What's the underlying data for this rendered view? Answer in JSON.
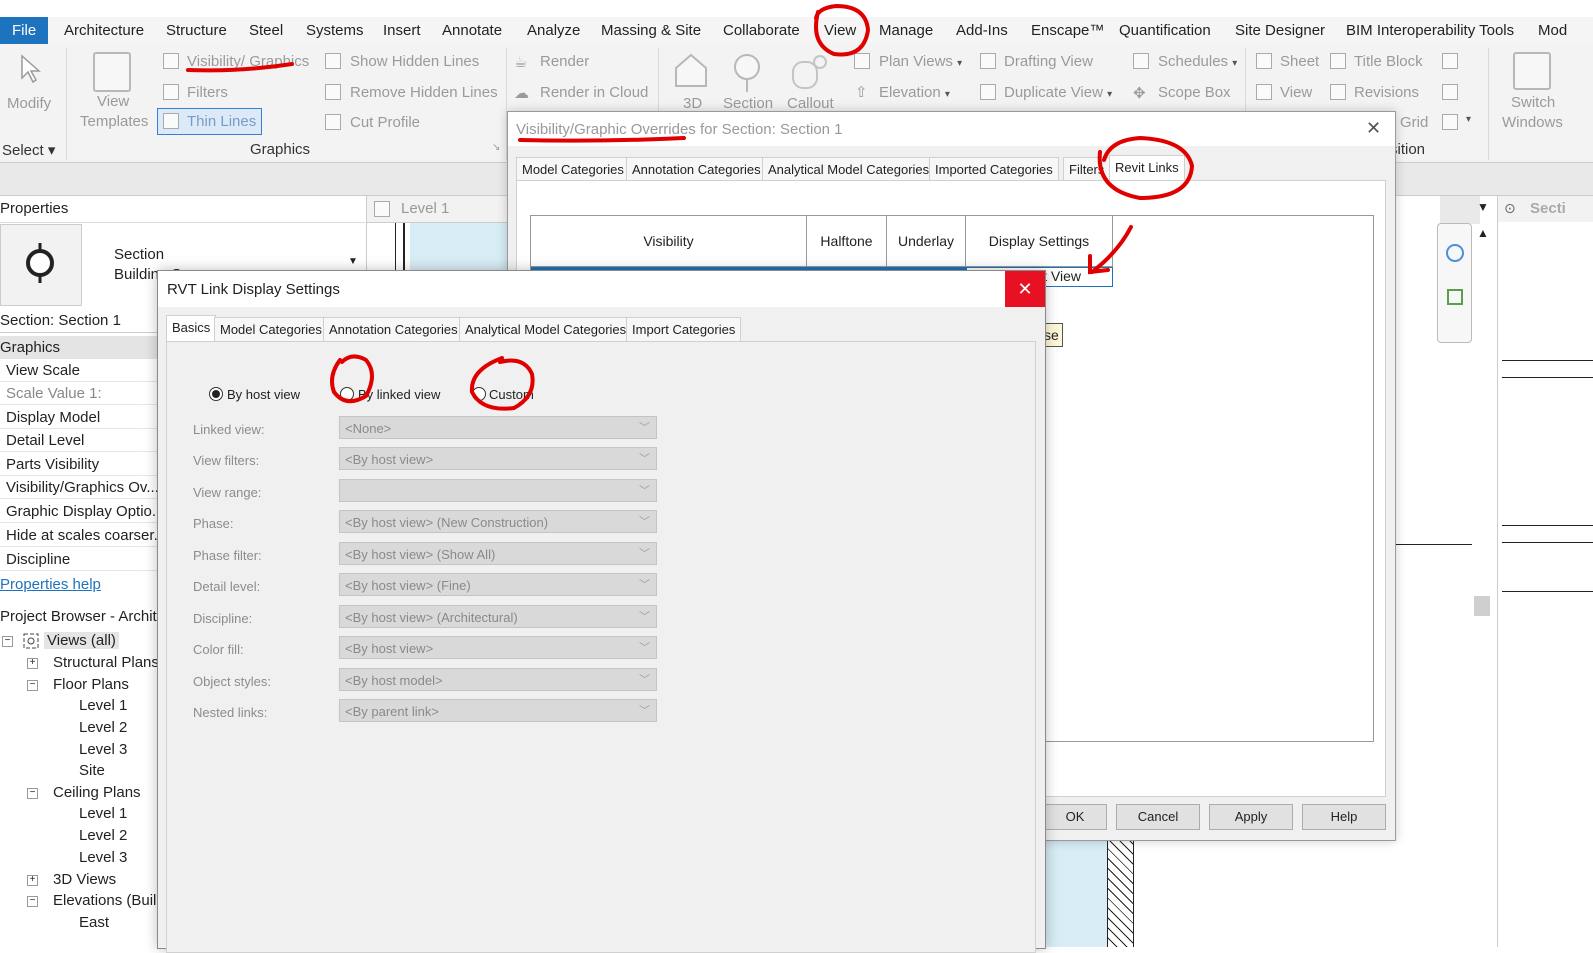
{
  "menu": [
    "File",
    "Architecture",
    "Structure",
    "Steel",
    "Systems",
    "Insert",
    "Annotate",
    "Analyze",
    "Massing & Site",
    "Collaborate",
    "View",
    "Manage",
    "Add-Ins",
    "Enscape™",
    "Quantification",
    "Site Designer",
    "BIM Interoperability Tools",
    "Mod"
  ],
  "ribbon": {
    "modify": "Modify",
    "select": "Select",
    "view_templates_1": "View",
    "view_templates_2": "Templates",
    "visibility_graphics": "Visibility/ Graphics",
    "filters": "Filters",
    "thin_lines": "Thin Lines",
    "show_hidden_lines": "Show Hidden Lines",
    "remove_hidden_lines": "Remove Hidden Lines",
    "cut_profile": "Cut Profile",
    "graphics_group": "Graphics",
    "render": "Render",
    "render_cloud": "Render in Cloud",
    "btn_3d": "3D",
    "section": "Section",
    "callout": "Callout",
    "plan_views": "Plan Views",
    "elevation": "Elevation",
    "drafting_view": "Drafting View",
    "duplicate_view": "Duplicate View",
    "schedules": "Schedules",
    "scope_box": "Scope Box",
    "sheet": "Sheet",
    "title_block": "Title Block",
    "view": "View",
    "revisions": "Revisions",
    "grid": "Grid",
    "sition": "sition",
    "switch_windows_1": "Switch",
    "switch_windows_2": "Windows"
  },
  "properties": {
    "header": "Properties",
    "type_1": "Section",
    "type_2": "Building Se",
    "instance": "Section: Section 1",
    "group": "Graphics",
    "rows": [
      "View Scale",
      "Scale Value    1:",
      "Display Model",
      "Detail Level",
      "Parts Visibility",
      "Visibility/Graphics Ov...",
      "Graphic Display Optio...",
      "Hide at scales coarser...",
      "Discipline"
    ],
    "help": "Properties help"
  },
  "browser": {
    "header": "Project Browser - Archite",
    "items": [
      "Views (all)",
      "Structural Plans",
      "Floor Plans",
      "Level 1",
      "Level 2",
      "Level 3",
      "Site",
      "Ceiling Plans",
      "Level 1",
      "Level 2",
      "Level 3",
      "3D Views",
      "Elevations (Buil",
      "East"
    ]
  },
  "view_tab": "Level 1",
  "right_panel_title": "Secti",
  "vg_dialog": {
    "title": "Visibility/Graphic Overrides for Section: Section 1",
    "tabs": [
      "Model Categories",
      "Annotation Categories",
      "Analytical Model Categories",
      "Imported Categories",
      "Filters",
      "Revit Links"
    ],
    "columns": [
      "Visibility",
      "Halftone",
      "Underlay",
      "Display Settings"
    ],
    "row_display": "By Host View",
    "buttons": [
      "OK",
      "Cancel",
      "Apply",
      "Help"
    ]
  },
  "tooltip": "Close",
  "rvt_dialog": {
    "title": "RVT Link Display Settings",
    "tabs": [
      "Basics",
      "Model Categories",
      "Annotation Categories",
      "Analytical Model Categories",
      "Import Categories"
    ],
    "radios": [
      "By host view",
      "By linked view",
      "Custom"
    ],
    "selected_radio": "By host view",
    "fields": [
      {
        "label": "Linked view:",
        "value": "<None>"
      },
      {
        "label": "View filters:",
        "value": "<By host view>"
      },
      {
        "label": "View range:",
        "value": ""
      },
      {
        "label": "Phase:",
        "value": "<By host view> (New Construction)"
      },
      {
        "label": "Phase filter:",
        "value": "<By host view> (Show All)"
      },
      {
        "label": "Detail level:",
        "value": "<By host view> (Fine)"
      },
      {
        "label": "Discipline:",
        "value": "<By host view> (Architectural)"
      },
      {
        "label": "Color fill:",
        "value": "<By host view>"
      },
      {
        "label": "Object styles:",
        "value": "<By host model>"
      },
      {
        "label": "Nested links:",
        "value": "<By parent link>"
      }
    ]
  },
  "colors": {
    "accent": "#1e73be",
    "close_red": "#e81123",
    "annotation": "#e00000"
  }
}
